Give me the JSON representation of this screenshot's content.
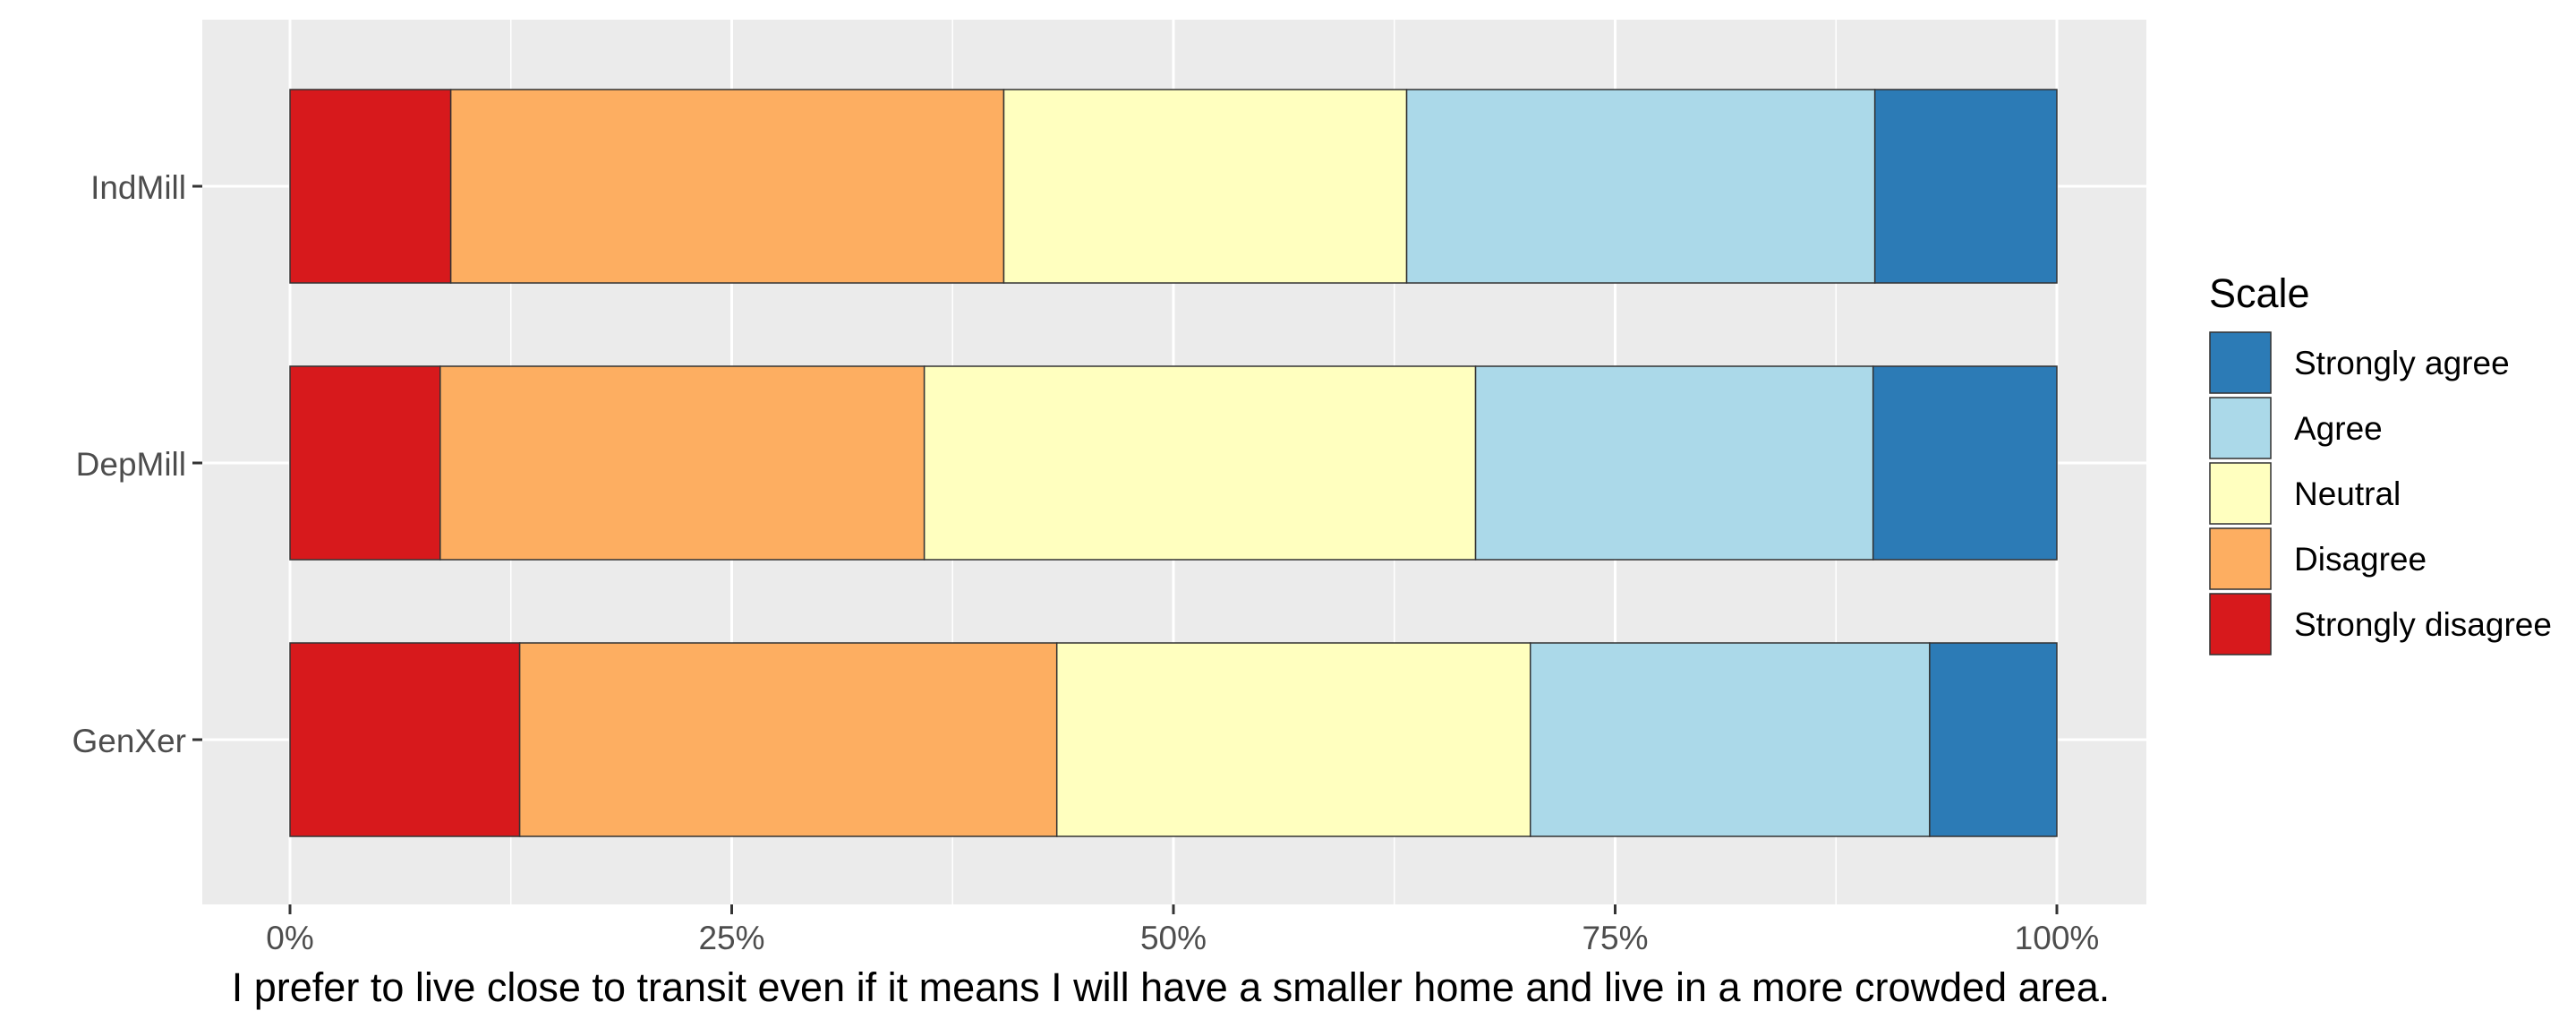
{
  "chart_data": {
    "type": "bar",
    "orientation": "horizontal",
    "stacked": true,
    "percent": true,
    "title": "",
    "xlabel": "I prefer to live close to transit even if it means I will have a smaller home and live in a more crowded area.",
    "ylabel": "",
    "xlim": [
      0,
      100
    ],
    "x_ticks": [
      "0%",
      "25%",
      "50%",
      "75%",
      "100%"
    ],
    "categories": [
      "IndMill",
      "DepMill",
      "GenXer"
    ],
    "series": [
      {
        "name": "Strongly disagree",
        "color": "#d7191c",
        "values": [
          9.1,
          8.5,
          13.0
        ]
      },
      {
        "name": "Disagree",
        "color": "#fdae61",
        "values": [
          31.3,
          27.4,
          30.4
        ]
      },
      {
        "name": "Neutral",
        "color": "#ffffbf",
        "values": [
          22.8,
          31.2,
          26.8
        ]
      },
      {
        "name": "Agree",
        "color": "#abd9e9",
        "values": [
          26.5,
          22.5,
          22.6
        ]
      },
      {
        "name": "Strongly agree",
        "color": "#2c7bb6",
        "values": [
          10.3,
          10.4,
          7.2
        ]
      }
    ],
    "legend": {
      "title": "Scale",
      "placement": "right",
      "order": [
        "Strongly agree",
        "Agree",
        "Neutral",
        "Disagree",
        "Strongly disagree"
      ]
    },
    "grid": true,
    "panel_background": "#ebebeb",
    "grid_color": "#ffffff"
  }
}
